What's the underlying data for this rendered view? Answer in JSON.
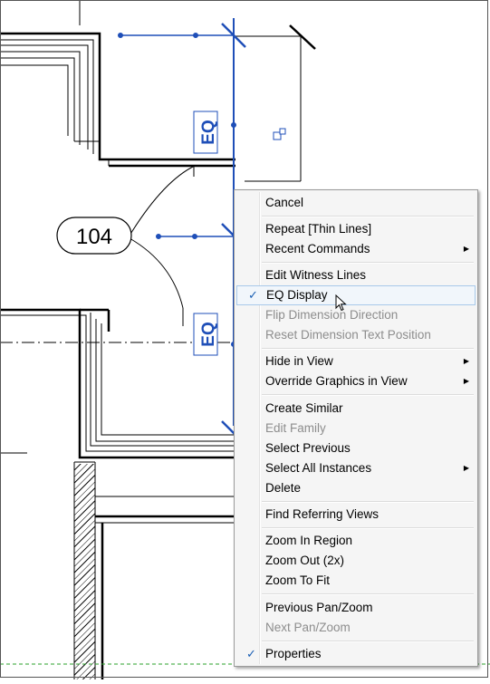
{
  "drawing": {
    "room_tag": "104",
    "eq_labels": [
      "EQ",
      "EQ"
    ]
  },
  "menu": {
    "items": [
      {
        "label": "Cancel",
        "state": "enabled"
      },
      {
        "label": "Repeat [Thin Lines]",
        "state": "enabled"
      },
      {
        "label": "Recent Commands",
        "state": "enabled",
        "submenu": true
      },
      {
        "label": "Edit Witness Lines",
        "state": "enabled"
      },
      {
        "label": "EQ Display",
        "state": "enabled",
        "checked": true,
        "hovered": true
      },
      {
        "label": "Flip Dimension Direction",
        "state": "disabled"
      },
      {
        "label": "Reset Dimension Text Position",
        "state": "disabled"
      },
      {
        "label": "Hide in View",
        "state": "enabled",
        "submenu": true
      },
      {
        "label": "Override Graphics in View",
        "state": "enabled",
        "submenu": true
      },
      {
        "label": "Create Similar",
        "state": "enabled"
      },
      {
        "label": "Edit Family",
        "state": "disabled"
      },
      {
        "label": "Select Previous",
        "state": "enabled"
      },
      {
        "label": "Select All Instances",
        "state": "enabled",
        "submenu": true
      },
      {
        "label": "Delete",
        "state": "enabled"
      },
      {
        "label": "Find Referring Views",
        "state": "enabled"
      },
      {
        "label": "Zoom In Region",
        "state": "enabled"
      },
      {
        "label": "Zoom Out (2x)",
        "state": "enabled"
      },
      {
        "label": "Zoom To Fit",
        "state": "enabled"
      },
      {
        "label": "Previous Pan/Zoom",
        "state": "enabled"
      },
      {
        "label": "Next Pan/Zoom",
        "state": "disabled"
      },
      {
        "label": "Properties",
        "state": "enabled",
        "checked": true
      }
    ],
    "check_glyph": "✓",
    "submenu_glyph": "▶"
  },
  "colors": {
    "dimension_blue": "#1f4fb8",
    "menu_hover_border": "#a8c9ea",
    "disabled_text": "#8d8d8d",
    "level_line_green": "#2aa02a"
  }
}
